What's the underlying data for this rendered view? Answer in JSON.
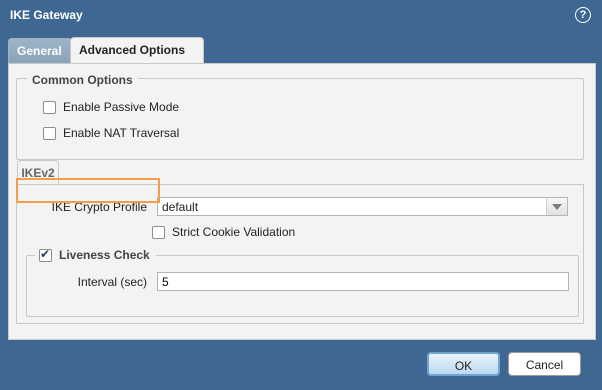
{
  "window": {
    "title": "IKE Gateway",
    "help_icon_glyph": "?"
  },
  "tabs": [
    {
      "label": "General",
      "active": false
    },
    {
      "label": "Advanced Options",
      "active": true
    }
  ],
  "common_options": {
    "legend": "Common Options",
    "enable_passive_mode": {
      "label": "Enable Passive Mode",
      "checked": false
    },
    "enable_nat_traversal": {
      "label": "Enable NAT Traversal",
      "checked": false
    }
  },
  "ikev2": {
    "tab_label": "IKEv2",
    "crypto_profile": {
      "label": "IKE Crypto Profile",
      "value": "default"
    },
    "strict_cookie": {
      "label": "Strict Cookie Validation",
      "checked": false
    },
    "liveness": {
      "label": "Liveness Check",
      "checked": true,
      "interval_label": "Interval (sec)",
      "interval_value": "5"
    }
  },
  "buttons": {
    "ok": "OK",
    "cancel": "Cancel"
  },
  "colors": {
    "background": "#3e6891",
    "panel": "#f3f3f3",
    "highlight": "#f0a04b",
    "ok_border": "#6fa4d3"
  }
}
